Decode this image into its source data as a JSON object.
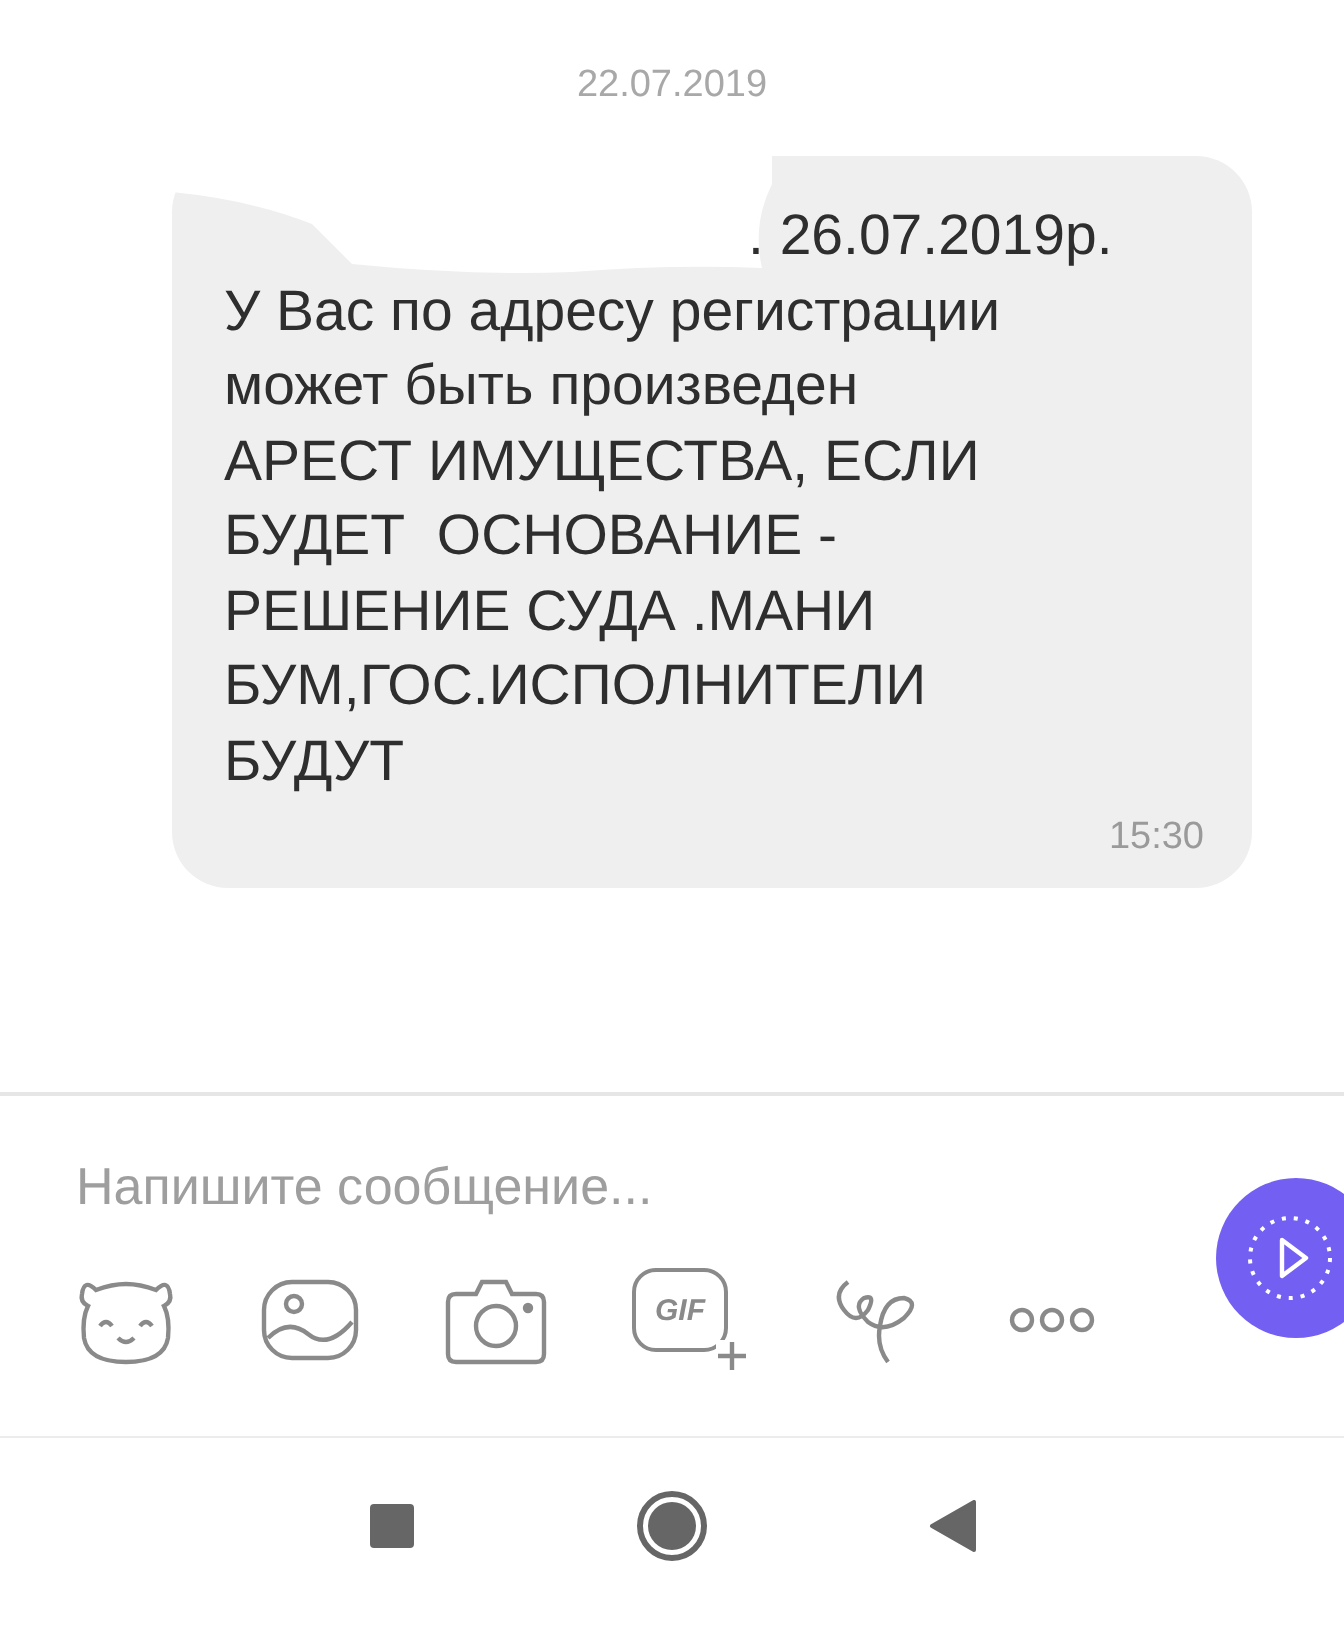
{
  "date_header": "22.07.2019",
  "message": {
    "redacted": true,
    "first_line": ". 26.07.2019р.",
    "lines": [
      "У Вас по адресу регистрации",
      "может быть произведен",
      "АРЕСТ ИМУЩЕСТВА, ЕСЛИ",
      "БУДЕТ  ОСНОВАНИЕ -",
      "РЕШЕНИЕ СУДА .МАНИ",
      "БУМ,ГОС.ИСПОЛНИТЕЛИ",
      "БУДУТ"
    ],
    "time": "15:30"
  },
  "composer": {
    "placeholder": "Напишите сообщение...",
    "gif_label": "GIF"
  }
}
